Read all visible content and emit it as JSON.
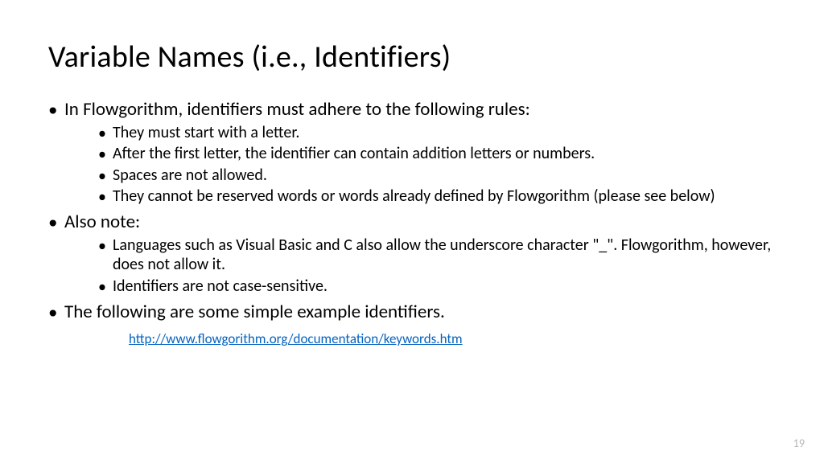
{
  "title": "Variable Names (i.e., Identifiers)",
  "bullets": {
    "b1": "In Flowgorithm, identifiers must adhere to the following rules:",
    "b1_sub": {
      "s1": "They must start with a letter.",
      "s2": "After the first letter, the identifier can contain addition letters or numbers.",
      "s3": "Spaces are not allowed.",
      "s4": "They cannot be reserved words or words already defined by Flowgorithm (please see below)"
    },
    "b2": "Also note:",
    "b2_sub": {
      "s1": "Languages such as Visual Basic and C also allow the underscore character \"_\". Flowgorithm, however, does not allow it.",
      "s2": "Identifiers are not case-sensitive."
    },
    "b3": "The following are some simple example identifiers."
  },
  "link": {
    "text": "http://www.flowgorithm.org/documentation/keywords.htm",
    "href": "http://www.flowgorithm.org/documentation/keywords.htm"
  },
  "page_number": "19"
}
